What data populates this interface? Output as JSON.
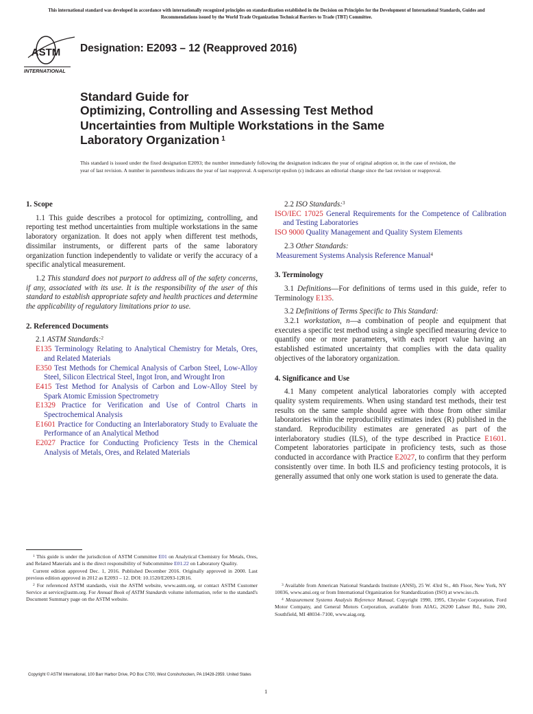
{
  "header": {
    "intl_notice": "This international standard was developed in accordance with internationally recognized principles on standardization established in the Decision on Principles for the Development of International Standards, Guides and Recommendations issued by the World Trade Organization Technical Barriers to Trade (TBT) Committee.",
    "logo_text": "ASTM",
    "logo_sub": "INTERNATIONAL",
    "designation": "Designation: E2093 – 12 (Reapproved 2016)"
  },
  "title": {
    "line1": "Standard Guide for",
    "line2": "Optimizing, Controlling and Assessing Test Method",
    "line3": "Uncertainties from Multiple Workstations in the Same",
    "line4": "Laboratory Organization",
    "footnote_mark": "1"
  },
  "issued_note": "This standard is issued under the fixed designation E2093; the number immediately following the designation indicates the year of original adoption or, in the case of revision, the year of last revision. A number in parentheses indicates the year of last reapproval. A superscript epsilon (ε) indicates an editorial change since the last revision or reapproval.",
  "colors": {
    "link_code": "#d2232a",
    "link_title": "#2e3192",
    "text": "#231f20"
  },
  "sections": {
    "scope": {
      "heading": "1. Scope",
      "p1": "1.1 This guide describes a protocol for optimizing, controlling, and reporting test method uncertainties from multiple workstations in the same laboratory organization. It does not apply when different test methods, dissimilar instruments, or different parts of the same laboratory organization function independently to validate or verify the accuracy of a specific analytical measurement.",
      "p2_num": "1.2",
      "p2_italic": "This standard does not purport to address all of the safety concerns, if any, associated with its use. It is the responsibility of the user of this standard to establish appropriate safety and health practices and determine the applicability of regulatory limitations prior to use."
    },
    "referenced": {
      "heading": "2. Referenced Documents",
      "astm_num": "2.1",
      "astm_label": "ASTM Standards:",
      "astm_fn": "2",
      "astm_refs": [
        {
          "code": "E135",
          "title": "Terminology Relating to Analytical Chemistry for Metals, Ores, and Related Materials"
        },
        {
          "code": "E350",
          "title": "Test Methods for Chemical Analysis of Carbon Steel, Low-Alloy Steel, Silicon Electrical Steel, Ingot Iron, and Wrought Iron"
        },
        {
          "code": "E415",
          "title": "Test Method for Analysis of Carbon and Low-Alloy Steel by Spark Atomic Emission Spectrometry"
        },
        {
          "code": "E1329",
          "title": "Practice for Verification and Use of Control Charts in Spectrochemical Analysis"
        },
        {
          "code": "E1601",
          "title": "Practice for Conducting an Interlaboratory Study to Evaluate the Performance of an Analytical Method"
        },
        {
          "code": "E2027",
          "title": "Practice for Conducting Proficiency Tests in the Chemical Analysis of Metals, Ores, and Related Materials"
        }
      ],
      "iso_num": "2.2",
      "iso_label": "ISO Standards:",
      "iso_fn": "3",
      "iso_refs": [
        {
          "code": "ISO/IEC 17025",
          "title": "General Requirements for the Competence of Calibration and Testing Laboratories"
        },
        {
          "code": "ISO 9000",
          "title": "Quality Management and Quality System Elements"
        }
      ],
      "other_num": "2.3",
      "other_label": "Other Standards:",
      "other_ref": "Measurement Systems Analysis Reference Manual",
      "other_fn": "4"
    },
    "terminology": {
      "heading": "3. Terminology",
      "p31_num": "3.1",
      "p31_term": "Definitions",
      "p31_text": "—For definitions of terms used in this guide, refer to Terminology ",
      "p31_link": "E135",
      "p31_end": ".",
      "p32_num": "3.2",
      "p32_label": "Definitions of Terms Specific to This Standard:",
      "p321_num": "3.2.1",
      "p321_term": "workstation, n",
      "p321_text": "—a combination of people and equipment that executes a specific test method using a single specified measuring device to quantify one or more parameters, with each report value having an established estimated uncertainty that complies with the data quality objectives of the laboratory organization."
    },
    "significance": {
      "heading": "4. Significance and Use",
      "p1_a": "4.1 Many competent analytical laboratories comply with accepted quality system requirements. When using standard test methods, their test results on the same sample should agree with those from other similar laboratories within the reproducibility estimates index (R) published in the standard. Reproducibility estimates are generated as part of the interlaboratory studies (ILS), of the type described in Practice ",
      "p1_link1": "E1601",
      "p1_b": ". Competent laboratories participate in proficiency tests, such as those conducted in accordance with Practice ",
      "p1_link2": "E2027",
      "p1_c": ", to confirm that they perform consistently over time. In both ILS and proficiency testing protocols, it is generally assumed that only one work station is used to generate the data."
    }
  },
  "footnotes": {
    "fn1_mark": "1",
    "fn1_a": "This guide is under the jurisdiction of ASTM Committee ",
    "fn1_link1": "E01",
    "fn1_b": " on Analytical Chemistry for Metals, Ores, and Related Materials and is the direct responsibility of Subcommittee ",
    "fn1_link2": "E01.22",
    "fn1_c": " on Laboratory Quality.",
    "fn1_edition": "Current edition approved Dec. 1, 2016. Published December 2016. Originally approved in 2000. Last previous edition approved in 2012 as E2093 – 12. DOI: 10.1520/E2093-12R16.",
    "fn2_mark": "2",
    "fn2_a": "For referenced ASTM standards, visit the ASTM website, www.astm.org, or contact ASTM Customer Service at service@astm.org. For ",
    "fn2_italic": "Annual Book of ASTM Standards",
    "fn2_b": " volume information, refer to the standard's Document Summary page on the ASTM website.",
    "fn3_mark": "3",
    "fn3": "Available from American National Standards Institute (ANSI), 25 W. 43rd St., 4th Floor, New York, NY 10036, www.ansi.org or from International Organization for Standardization (ISO) at www.iso.ch.",
    "fn4_mark": "4",
    "fn4_italic": "Measurement Systems Analysis Reference Manual",
    "fn4": ", Copyright 1990, 1995, Chrysler Corporation, Ford Motor Company, and General Motors Corporation, available from AIAG, 26200 Lahser Rd., Suite 200, Southfield, MI 48034–7100, www.aiag.org."
  },
  "footer": {
    "copyright": "Copyright © ASTM International, 100 Barr Harbor Drive, PO Box C700, West Conshohocken, PA 19428-2959. United States",
    "page_number": "1"
  }
}
